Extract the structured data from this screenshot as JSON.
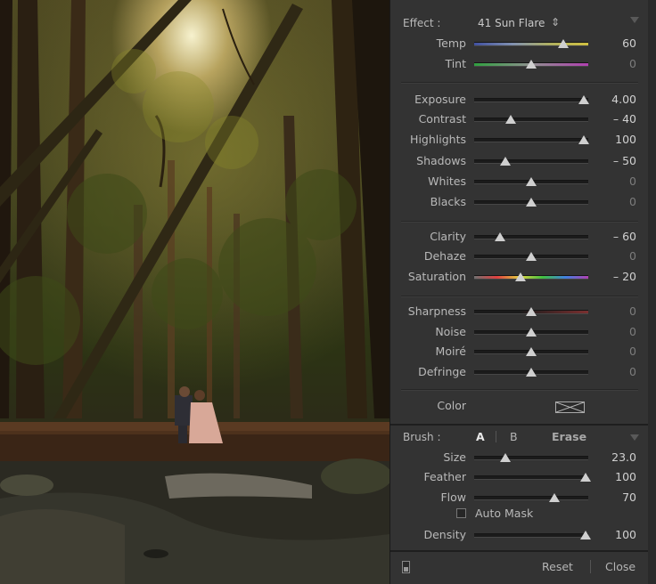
{
  "effect": {
    "label": "Effect :",
    "preset": "41 Sun Flare",
    "preset_arrows": "⇕"
  },
  "sections": [
    {
      "sliders": [
        {
          "label": "Temp",
          "value": "60",
          "pos": 0.78,
          "zero": false,
          "track": "temp"
        },
        {
          "label": "Tint",
          "value": "0",
          "pos": 0.5,
          "zero": true,
          "track": "tint"
        }
      ]
    },
    {
      "sliders": [
        {
          "label": "Exposure",
          "value": "4.00",
          "pos": 0.96,
          "zero": false
        },
        {
          "label": "Contrast",
          "value": "– 40",
          "pos": 0.32,
          "zero": false
        },
        {
          "label": "Highlights",
          "value": "100",
          "pos": 0.96,
          "zero": false
        },
        {
          "label": "Shadows",
          "value": "– 50",
          "pos": 0.27,
          "zero": false
        },
        {
          "label": "Whites",
          "value": "0",
          "pos": 0.5,
          "zero": true
        },
        {
          "label": "Blacks",
          "value": "0",
          "pos": 0.5,
          "zero": true
        }
      ]
    },
    {
      "sliders": [
        {
          "label": "Clarity",
          "value": "– 60",
          "pos": 0.23,
          "zero": false
        },
        {
          "label": "Dehaze",
          "value": "0",
          "pos": 0.5,
          "zero": true
        },
        {
          "label": "Saturation",
          "value": "– 20",
          "pos": 0.41,
          "zero": false,
          "track": "sat"
        }
      ]
    },
    {
      "sliders": [
        {
          "label": "Sharpness",
          "value": "0",
          "pos": 0.5,
          "zero": true,
          "track": "sharp"
        },
        {
          "label": "Noise",
          "value": "0",
          "pos": 0.5,
          "zero": true
        },
        {
          "label": "Moiré",
          "value": "0",
          "pos": 0.5,
          "zero": true
        },
        {
          "label": "Defringe",
          "value": "0",
          "pos": 0.5,
          "zero": true
        }
      ]
    }
  ],
  "color": {
    "label": "Color"
  },
  "brush": {
    "label": "Brush :",
    "a": "A",
    "b": "B",
    "erase": "Erase",
    "sliders": [
      {
        "label": "Size",
        "value": "23.0",
        "pos": 0.27,
        "zero": false
      },
      {
        "label": "Feather",
        "value": "100",
        "pos": 0.98,
        "zero": false
      },
      {
        "label": "Flow",
        "value": "70",
        "pos": 0.7,
        "zero": false
      }
    ],
    "automask": "Auto Mask",
    "density": {
      "label": "Density",
      "value": "100",
      "pos": 0.98,
      "zero": false
    }
  },
  "footer": {
    "reset": "Reset",
    "close": "Close"
  },
  "colors": {
    "panel": "#333333",
    "track": "#1b1b1b",
    "thumb": "#cfcfcf"
  }
}
